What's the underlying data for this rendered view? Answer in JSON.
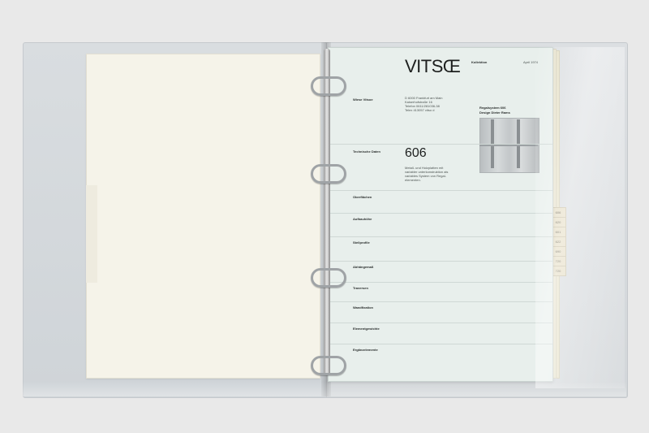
{
  "sheet": {
    "brand": "VITSŒ",
    "brand_sub": "Kollektion",
    "date": "April 1974",
    "company": "Wiese Vitsoe",
    "address": [
      "D 6000 Frankfurt am Main",
      "Kaiserhofstraße 16",
      "Telefon 0611/281036-38",
      "Telex 413057 vitso d"
    ],
    "system_title": "Regalsystem 606",
    "designer": "Design Dieter Rams",
    "section_label": "Technische Daten",
    "model_number": "606",
    "intro": [
      "Metall- und Holzplatten mit",
      "variabler unterkonstruktion als",
      "variables System von Regal-",
      "elementen."
    ],
    "rows": [
      {
        "label": "Oberflächen"
      },
      {
        "label": "Aufbauhöhe"
      },
      {
        "label": "Stellprofile"
      },
      {
        "label": "Abhängemaß"
      },
      {
        "label": "Traversen"
      },
      {
        "label": "Wandfixation"
      },
      {
        "label": "Elementgewichte"
      },
      {
        "label": "Ergänzelemente"
      }
    ]
  },
  "index_tabs": [
    "606",
    "620",
    "601",
    "622",
    "690",
    "720",
    "720"
  ]
}
